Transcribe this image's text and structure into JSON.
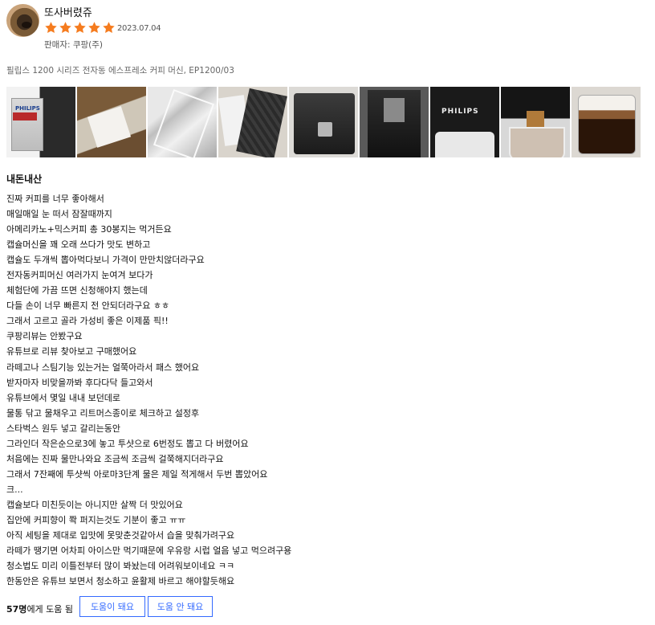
{
  "review": {
    "username": "또사버렸쥬",
    "rating": 5,
    "rating_max": 5,
    "date": "2023.07.04",
    "seller": "판매자: 쿠팡(주)",
    "product_name": "필립스 1200 시리즈 전자동 에스프레소 커피 머신, EP1200/03",
    "title": "내돈내산",
    "star_color": "#f57c1f",
    "body_lines": [
      "진짜 커피를 너무 좋아해서",
      "매일매일 눈 떠서 잠잘때까지",
      "아메리카노+믹스커피 총 30봉지는 먹거든요",
      "캡슐머신을 꽤 오래 쓰다가 맛도 변하고",
      "캡슐도 두개씩 뽑아먹다보니 가격이 만만치않더라구요",
      "전자동커피머신 여러가지 눈여겨 보다가",
      "체험단에 가끔 뜨면 신청해야지 했는데",
      "다들 손이 너무 빠른지 전 안되더라구요 ㅎㅎ",
      "그래서 고르고 골라 가성비 좋은 이제품 픽!!",
      "쿠팡리뷰는 안봤구요",
      "유튜브로 리뷰 찾아보고 구매했어요",
      "라떼고나 스팀기능 있는거는 얼쭉아라서 패스 했어요",
      "받자마자 비맞을까봐 후다다닥 들고와서",
      "유튜브에서 몇일 내내 보던데로",
      "물통 닦고 물채우고 리트머스종이로 체크하고 설정후",
      "스타벅스 원두 넣고 갈리는동안",
      "그라인더 작은순으로3에 놓고 투샷으로 6번정도 뽑고 다 버렸어요",
      "처음에는 진짜 물만나와요 조금씩 조금씩 걸쭉해지더라구요",
      "그래서 7잔째에 투샷씩 아로마3단계 물은 제일 적게해서 두번 뽑았어요",
      "크...",
      "캡슐보다 미친듯이는 아니지만 살짝 더 맛있어요",
      "집안에 커피향이 쫙 퍼지는것도 기분이 좋고 ㅠㅠ",
      "아직 세팅을 제대로 입맛에 못맞춘것같아서 습을 맞춰가려구요",
      "라떼가 땡기면 어차피 아이스만 먹기때문에 우유랑 시럽 얼음 넣고 먹으려구용",
      "청소법도 미리 이틀전부터 많이 봐놨는데 어려워보이네요 ㅋㅋ",
      "한동안은 유튜브 보면서 청소하고 윤활제 바르고 해야할듯해요"
    ],
    "helpful_count": "57명",
    "helpful_suffix": "에게 도움 됨",
    "helpful_yes_label": "도움이 돼요",
    "helpful_no_label": "도움 안 돼요",
    "photos": [
      {
        "icon": "product-box-photo"
      },
      {
        "icon": "unboxing-photo"
      },
      {
        "icon": "plastic-wrap-photo"
      },
      {
        "icon": "drip-tray-photo"
      },
      {
        "icon": "machine-front-photo"
      },
      {
        "icon": "machine-side-photo"
      },
      {
        "icon": "philips-logo-photo"
      },
      {
        "icon": "espresso-pouring-photo"
      },
      {
        "icon": "coffee-glass-photo"
      }
    ]
  }
}
